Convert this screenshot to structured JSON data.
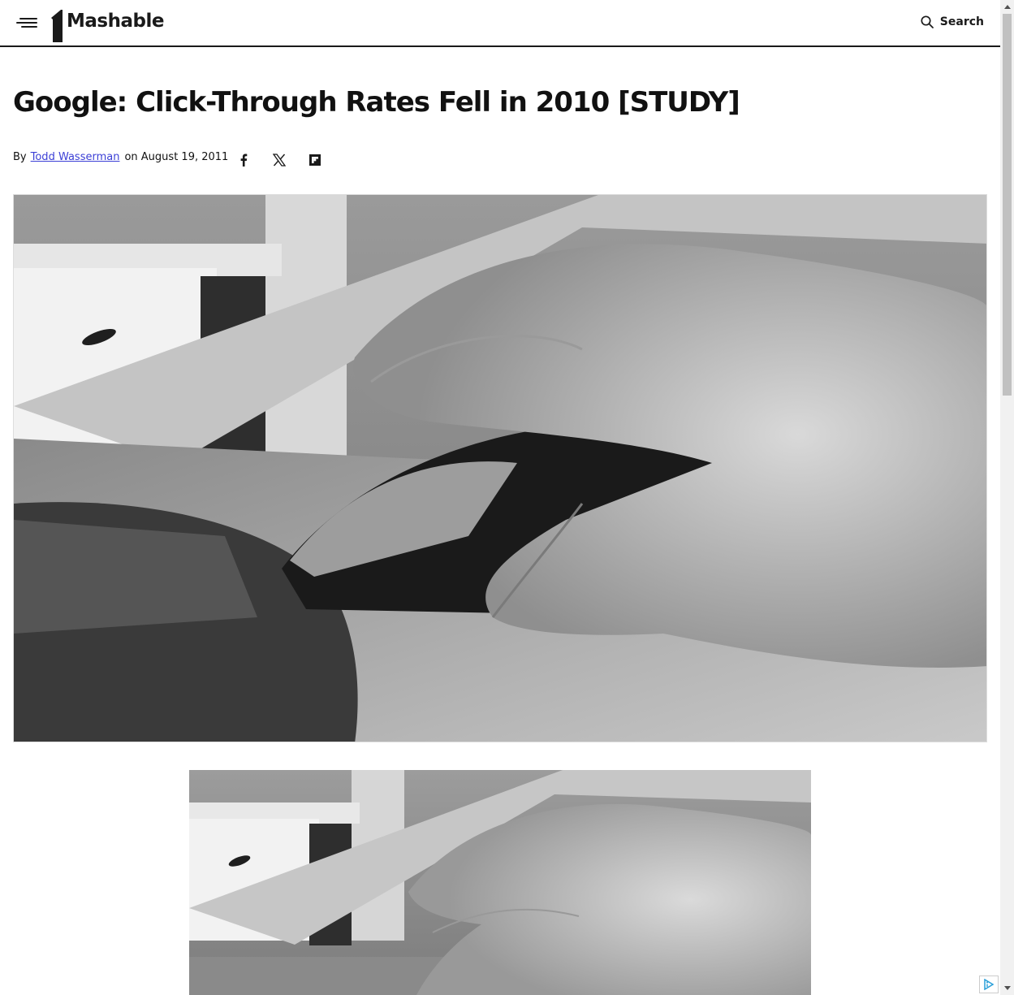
{
  "header": {
    "logo_text": "Mashable",
    "search_label": "Search"
  },
  "article": {
    "title": "Google: Click-Through Rates Fell in 2010 [STUDY]",
    "byline_prefix": "By",
    "author": "Todd Wasserman",
    "date": "on August 19, 2011"
  },
  "share": {
    "items": [
      "facebook-icon",
      "x-icon",
      "flipboard-icon"
    ]
  },
  "colors": {
    "link": "#3b3fd6",
    "text": "#111111",
    "header_border": "#1a1a1a"
  }
}
